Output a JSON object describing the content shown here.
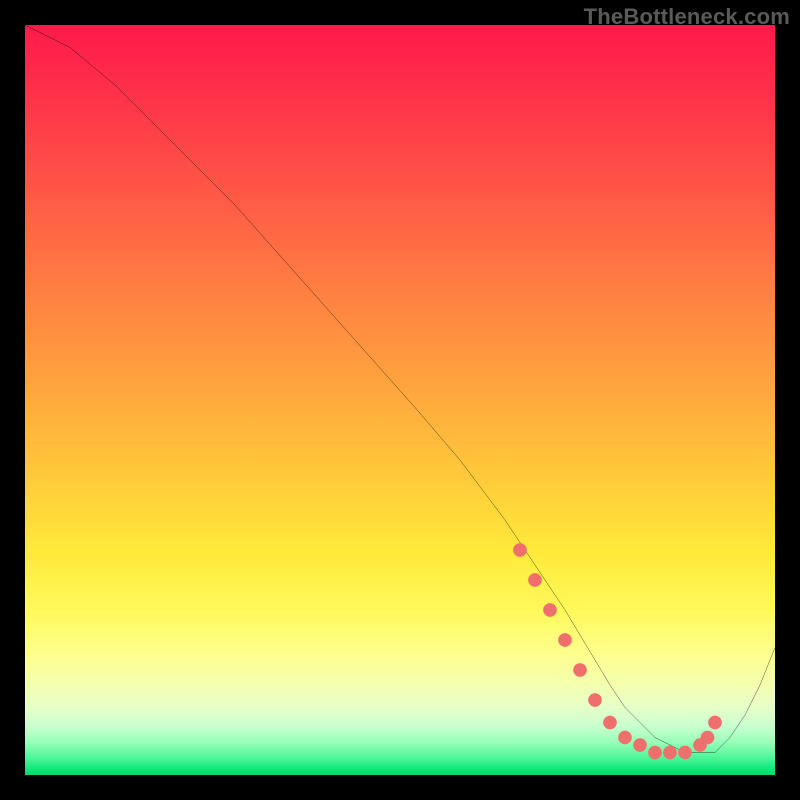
{
  "watermark": "TheBottleneck.com",
  "colors": {
    "line": "#000000",
    "dots": "#ef6f6d",
    "dots_stroke": "#ef6f6d",
    "frame_bg": "#000000"
  },
  "chart_data": {
    "type": "line",
    "title": "",
    "xlabel": "",
    "ylabel": "",
    "xlim": [
      0,
      100
    ],
    "ylim": [
      0,
      100
    ],
    "x": [
      0,
      6,
      12,
      20,
      28,
      36,
      44,
      52,
      58,
      64,
      68,
      72,
      75,
      78,
      80,
      82,
      84,
      86,
      88,
      90,
      92,
      94,
      96,
      98,
      100
    ],
    "values": [
      100,
      97,
      92,
      84,
      76,
      67,
      58,
      49,
      42,
      34,
      28,
      22,
      17,
      12,
      9,
      7,
      5,
      4,
      3,
      3,
      3,
      5,
      8,
      12,
      17
    ],
    "highlight_points": {
      "x": [
        66,
        68,
        70,
        72,
        74,
        76,
        78,
        80,
        82,
        84,
        86,
        88,
        90,
        91,
        92
      ],
      "values": [
        30,
        26,
        22,
        18,
        14,
        10,
        7,
        5,
        4,
        3,
        3,
        3,
        4,
        5,
        7
      ]
    }
  }
}
